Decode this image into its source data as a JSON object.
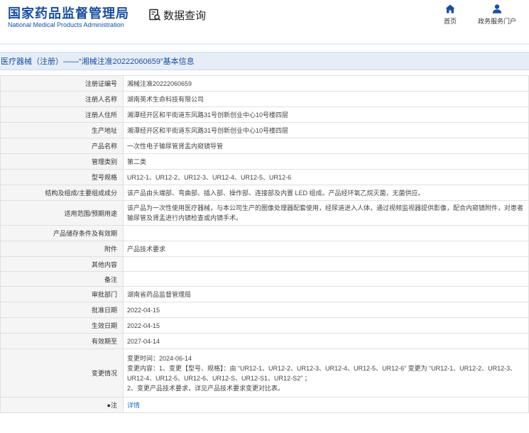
{
  "header": {
    "logo_cn": "国家药品监督管理局",
    "logo_en": "National Medical Products Administration",
    "query_title": "数据查询",
    "nav": {
      "home": "首页",
      "gov": "政务服务门户"
    }
  },
  "section_title": "医疗器械（注册）——“湘械注准20222060659”基本信息",
  "rows": {
    "reg_no": {
      "label": "注册证编号",
      "value": "湘械注准20222060659"
    },
    "registrant": {
      "label": "注册人名称",
      "value": "湖南英术生命科技有限公司"
    },
    "residence": {
      "label": "注册人住所",
      "value": "湘潭经开区和平街道东风路31号创新创业中心10号楼四层"
    },
    "prod_addr": {
      "label": "生产地址",
      "value": "湘潭经开区和平街道东风路31号创新创业中心10号楼四层"
    },
    "product_name": {
      "label": "产品名称",
      "value": "一次性电子输尿管肾盂内窥镜导管"
    },
    "mgmt_class": {
      "label": "管理类别",
      "value": "第二类"
    },
    "model": {
      "label": "型号规格",
      "value": "UR12-1、UR12-2、UR12-3、UR12-4、UR12-5、UR12-6"
    },
    "structure": {
      "label": "结构及组成/主要组成成分",
      "value": "该产品由头端部、弯曲部、插入部、操作部、连接部及内置 LED 组成。产品经环氧乙烷灭菌，无菌供应。"
    },
    "scope": {
      "label": "适用范围/预期用途",
      "value": "该产品为一次性使用医疗器械，与本公司生产的图像处理器配套使用，经尿道进入人体，通过视频监视器提供影像，配合内窥镜附件，对患者输尿管及肾盂进行内镜检查或内镜手术。"
    },
    "storage": {
      "label": "产品储存条件及有效期",
      "value": ""
    },
    "attachment": {
      "label": "附件",
      "value": "产品技术要求"
    },
    "other": {
      "label": "其他内容",
      "value": ""
    },
    "remark": {
      "label": "备注",
      "value": ""
    },
    "dept": {
      "label": "审批部门",
      "value": "湖南省药品监督管理局"
    },
    "approval_date": {
      "label": "批准日期",
      "value": "2022-04-15"
    },
    "effective_date": {
      "label": "生效日期",
      "value": "2022-04-15"
    },
    "valid_until": {
      "label": "有效期至",
      "value": "2027-04-14"
    },
    "change": {
      "label": "变更情况",
      "line1": "变更时间：2024-06-14",
      "line2": "变更内容：1、变更【型号、规格】：由 “UR12-1、UR12-2、UR12-3、UR12-4、UR12-5、UR12-6” 变更为 “UR12-1、UR12-2、UR12-3、UR12-4、UR12-5、UR12-6、UR12-S、UR12-S1、UR12-S2” ；",
      "line3": "2、变更产品技术要求，详见产品技术要求变更对比表。"
    },
    "note": {
      "label": "注",
      "value": "详情"
    }
  }
}
